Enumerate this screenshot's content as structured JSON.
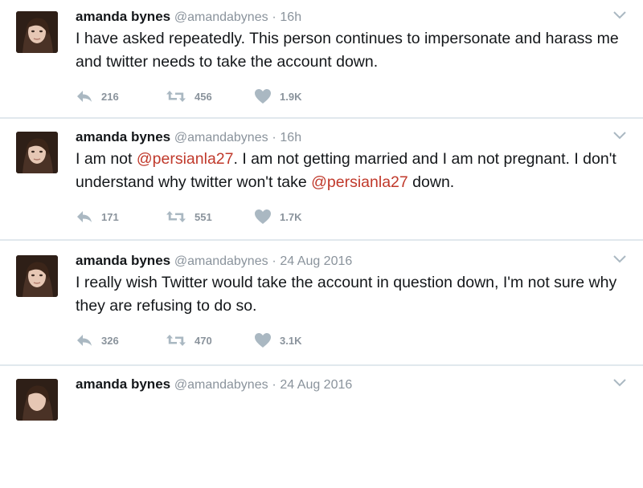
{
  "tweets": [
    {
      "name": "amanda bynes",
      "handle": "@amandabynes",
      "separator": "·",
      "time": "16h",
      "text_parts": [
        "I have asked repeatedly. This person continues to impersonate and harass me and twitter needs to take the account down."
      ],
      "replies": "216",
      "retweets": "456",
      "likes": "1.9K"
    },
    {
      "name": "amanda bynes",
      "handle": "@amandabynes",
      "separator": "·",
      "time": "16h",
      "text_parts": [
        "I am not ",
        "@persianla27",
        ". I am not getting married and I am not pregnant. I don't understand why twitter won't take ",
        "@persianla27",
        " down."
      ],
      "replies": "171",
      "retweets": "551",
      "likes": "1.7K"
    },
    {
      "name": "amanda bynes",
      "handle": "@amandabynes",
      "separator": "·",
      "time": "24 Aug 2016",
      "text_parts": [
        "I really wish Twitter would take the account in question down, I'm not sure why they are refusing to do so."
      ],
      "replies": "326",
      "retweets": "470",
      "likes": "3.1K"
    },
    {
      "name": "amanda bynes",
      "handle": "@amandabynes",
      "separator": "·",
      "time": "24 Aug 2016"
    }
  ],
  "icons": {
    "reply": "reply-icon",
    "retweet": "retweet-icon",
    "like": "heart-icon",
    "more": "chevron-down-icon",
    "avatar": "avatar"
  },
  "colors": {
    "text": "#14171a",
    "secondary": "#8a939c",
    "mention": "#c0392b",
    "icon": "#aab8c2",
    "divider": "#e1e8ed"
  }
}
